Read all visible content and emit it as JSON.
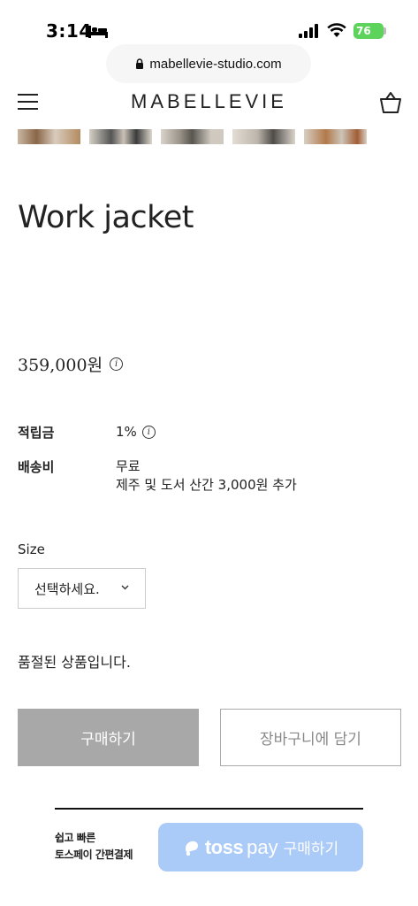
{
  "status_bar": {
    "time": "3:14",
    "battery": "76"
  },
  "browser": {
    "url": "mabellevie-studio.com"
  },
  "nav": {
    "brand": "MABELLEVIE"
  },
  "product": {
    "title": "Work jacket",
    "price": "359,000원",
    "info_icon_glyph": "i",
    "points_label": "적립금",
    "points_value": "1%",
    "shipping_label": "배송비",
    "shipping_value": "무료",
    "shipping_note": "제주 및 도서 산간 3,000원 추가"
  },
  "options": {
    "size_label": "Size",
    "size_selected": "선택하세요."
  },
  "soldout_message": "품절된 상품입니다.",
  "actions": {
    "buy_label": "구매하기",
    "cart_label": "장바구니에 담기"
  },
  "toss": {
    "caption_line1": "쉽고 빠른",
    "caption_line2": "토스페이 간편결제",
    "brand": "toss",
    "pay": "pay",
    "action": "구매하기"
  },
  "colors": {
    "buy_button": "#a8a8a8",
    "toss_button": "#aacaf7",
    "battery": "#5dd35b"
  }
}
